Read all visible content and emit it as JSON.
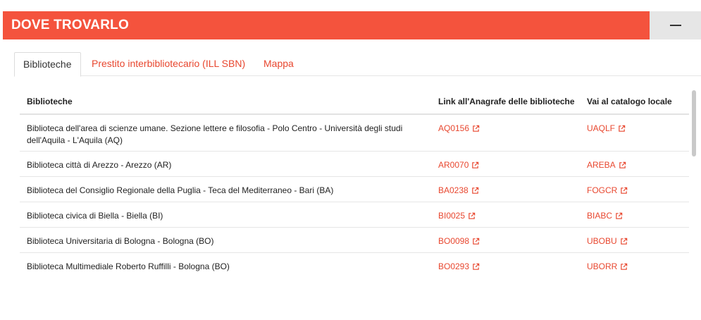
{
  "header": {
    "title": "DOVE TROVARLO",
    "collapse_icon": "minus-icon"
  },
  "tabs": [
    {
      "label": "Biblioteche",
      "active": true
    },
    {
      "label": "Prestito interbibliotecario (ILL SBN)",
      "active": false
    },
    {
      "label": "Mappa",
      "active": false
    }
  ],
  "table": {
    "columns": [
      "Biblioteche",
      "Link all'Anagrafe delle biblioteche",
      "Vai al catalogo locale"
    ],
    "rows": [
      {
        "name": "Biblioteca dell'area di scienze umane. Sezione lettere e filosofia - Polo Centro - Università degli studi dell'Aquila - L'Aquila (AQ)",
        "code": "AQ0156",
        "catalog": "UAQLF"
      },
      {
        "name": "Biblioteca città di Arezzo - Arezzo (AR)",
        "code": "AR0070",
        "catalog": "AREBA"
      },
      {
        "name": "Biblioteca del Consiglio Regionale della Puglia - Teca del Mediterraneo - Bari (BA)",
        "code": "BA0238",
        "catalog": "FOGCR"
      },
      {
        "name": "Biblioteca civica di Biella - Biella (BI)",
        "code": "BI0025",
        "catalog": "BIABC"
      },
      {
        "name": "Biblioteca Universitaria di Bologna - Bologna (BO)",
        "code": "BO0098",
        "catalog": "UBOBU"
      },
      {
        "name": "Biblioteca Multimediale Roberto Ruffilli - Bologna (BO)",
        "code": "BO0293",
        "catalog": "UBORR"
      }
    ]
  },
  "colors": {
    "accent": "#f4533d",
    "link": "#e8472f"
  }
}
